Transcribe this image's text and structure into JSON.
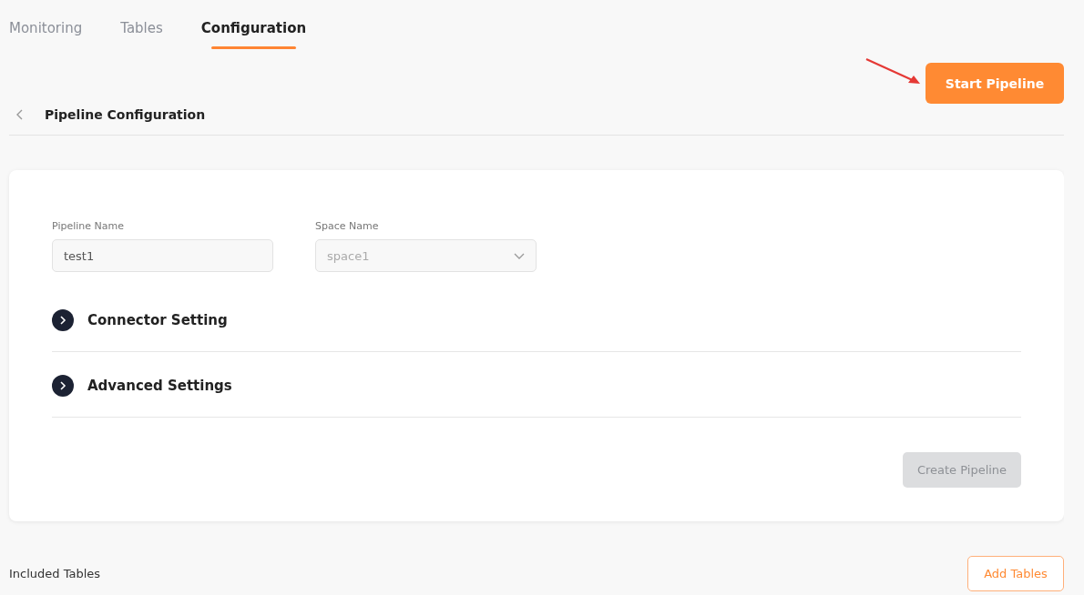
{
  "tabs": [
    {
      "label": "Monitoring",
      "selected": false
    },
    {
      "label": "Tables",
      "selected": false
    },
    {
      "label": "Configuration",
      "selected": true
    }
  ],
  "primary_action": {
    "label": "Start Pipeline"
  },
  "header": {
    "title": "Pipeline Configuration"
  },
  "form": {
    "fields": [
      {
        "kind": "text",
        "label": "Pipeline Name",
        "value": "test1",
        "disabled": false
      },
      {
        "kind": "select",
        "label": "Space Name",
        "value": "space1",
        "disabled": true
      }
    ],
    "sections": [
      {
        "title": "Connector Setting",
        "expanded": false
      },
      {
        "title": "Advanced Settings",
        "expanded": false
      }
    ],
    "submit": {
      "label": "Create Pipeline",
      "disabled": true
    }
  },
  "included_tables": {
    "label": "Included Tables",
    "button": "Add Tables"
  }
}
